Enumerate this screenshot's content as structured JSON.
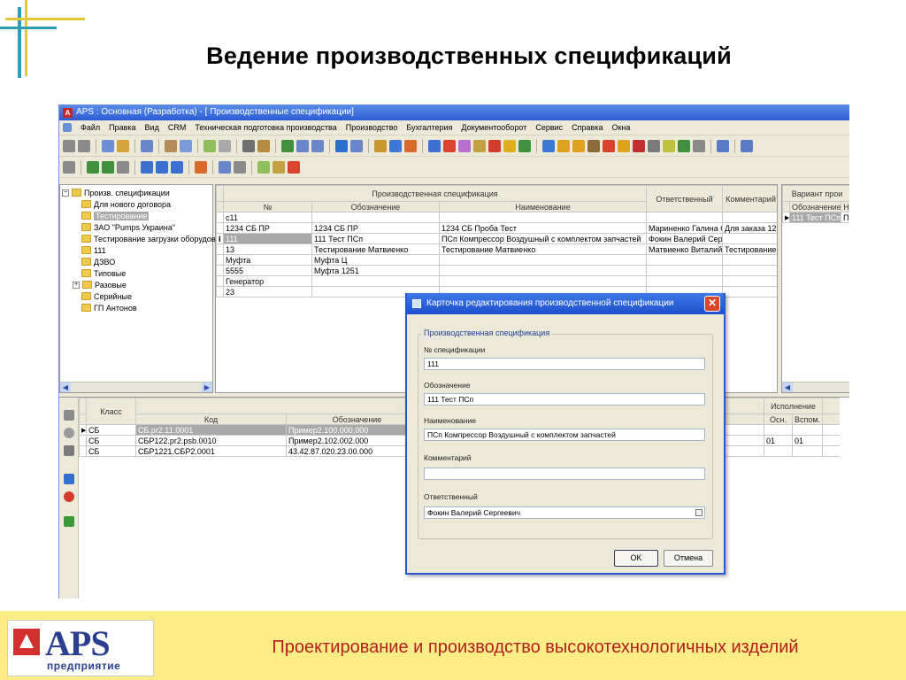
{
  "slide": {
    "title": "Ведение производственных спецификаций",
    "footer_slogan": "Проектирование и производство высокотехнологичных изделий",
    "logo_text": "APS",
    "logo_subtext": "предприятие",
    "colors": {
      "footer_bg": "#fcec86",
      "slogan": "#b01e1e",
      "logo": "#2a3f8f"
    }
  },
  "app": {
    "window_title": "APS : Основная (Разработка) - [ Производственные спецификации]",
    "menu": [
      "Файл",
      "Правка",
      "Вид",
      "CRM",
      "Техническая подготовка производства",
      "Производство",
      "Бухгалтерия",
      "Документооборот",
      "Сервис",
      "Справка",
      "Окна"
    ],
    "tree": {
      "root": "Произв. спецификации",
      "items": [
        {
          "label": "Для нового договора"
        },
        {
          "label": "Тестирование",
          "selected": true
        },
        {
          "label": "ЗАО \"Pumps Украина\""
        },
        {
          "label": "Тестирование загрузки оборудов"
        },
        {
          "label": "111"
        },
        {
          "label": "ДЗВО"
        },
        {
          "label": "Типовые"
        },
        {
          "label": "Разовые",
          "expandable": true
        },
        {
          "label": "Серийные"
        },
        {
          "label": "ГП Антонов"
        }
      ]
    },
    "spec_grid": {
      "group_header": "Производственная спецификация",
      "columns": [
        "№",
        "Обозначение",
        "Наименование",
        "Ответственный",
        "Комментарий"
      ],
      "rows": [
        [
          "с11",
          "",
          "",
          "",
          ""
        ],
        [
          "1234 СБ ПР",
          "1234 СБ ПР",
          "1234 СБ Проба Тест",
          "Мариненко Галина О",
          "Для заказа 123"
        ],
        [
          "111",
          "111 Тест ПСп",
          "ПСп Компрессор Воздушный с комплектом запчастей",
          "Фокин Валерий Серге",
          ""
        ],
        [
          "13",
          "Тестирование Матвиенко",
          "Тестирование Матвиенко",
          "Матвиенко Виталий В",
          "Тестирование М"
        ],
        [
          "Муфта",
          "Муфта Ц",
          "",
          "",
          ""
        ],
        [
          "5555",
          "Муфта 1251",
          "",
          "",
          ""
        ],
        [
          "Генератор",
          "",
          "",
          "",
          ""
        ],
        [
          "23",
          "",
          "",
          "",
          ""
        ]
      ],
      "selected_row": 2,
      "row_marker": "I"
    },
    "variant_grid": {
      "group_header": "Вариант прои",
      "columns": [
        "Обозначение",
        "Н"
      ],
      "rows": [
        [
          "111 Тест ПСп",
          "ПС"
        ]
      ]
    },
    "lower_grid": {
      "class_header": "Класс",
      "code_header": "Код",
      "designation_header": "Обозначение",
      "exec_header": "Исполнение",
      "exec_columns": [
        "Осн.",
        "Вспом."
      ],
      "rows": [
        {
          "class": "СБ",
          "code": "СБ.pr2.11.0001",
          "designation": "Пример2.100.000.000",
          "main": "",
          "aux": "",
          "selected": true
        },
        {
          "class": "СБ",
          "code": "СБР122.pr2.psb.0010",
          "designation": "Пример2.102.002.000",
          "main": "01",
          "aux": "01",
          "selected": false
        },
        {
          "class": "СБ",
          "code": "СБР1221.СБР2.0001",
          "designation": "43.42.87.020.23.00.000",
          "main": "",
          "aux": "",
          "selected": false
        }
      ]
    }
  },
  "dialog": {
    "title": "Карточка редактирования производственной спецификации",
    "group_title": "Производственная спецификация",
    "fields": [
      {
        "label": "№ спецификации",
        "value": "111"
      },
      {
        "label": "Обозначение",
        "value": "111 Тест ПСп"
      },
      {
        "label": "Наименование",
        "value": "ПСп Компрессор Воздушный с комплектом запчастей"
      },
      {
        "label": "Комментарий",
        "value": ""
      },
      {
        "label": "Ответственный",
        "value": "Фокин Валерий Сергеевич"
      }
    ],
    "ok_label": "OK",
    "cancel_label": "Отмена",
    "close_symbol": "✕"
  }
}
